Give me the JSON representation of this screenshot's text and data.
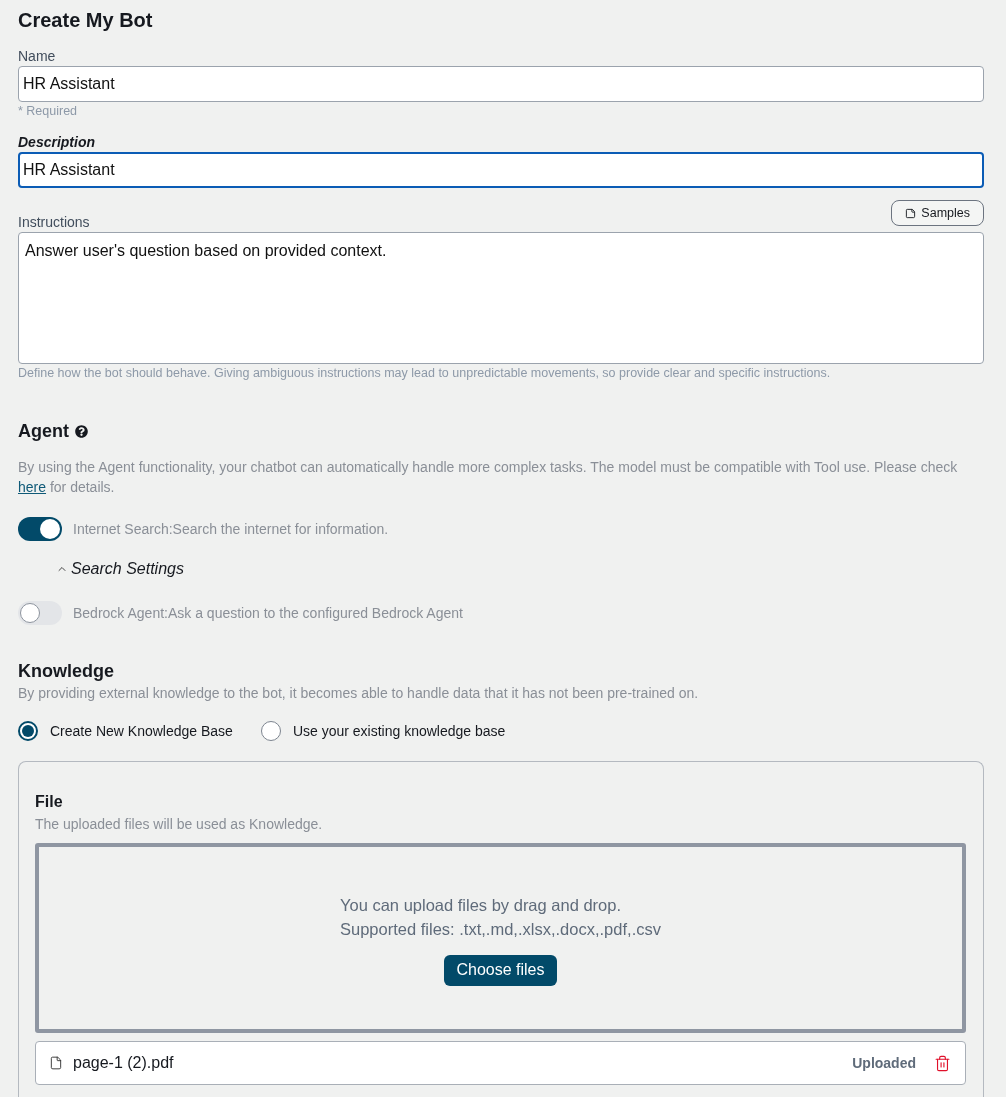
{
  "title": "Create My Bot",
  "name_field": {
    "label": "Name",
    "value": "HR Assistant",
    "hint": "* Required",
    "focused": false
  },
  "description_field": {
    "label": "Description",
    "value": "HR Assistant",
    "focused": true
  },
  "instructions_field": {
    "label": "Instructions",
    "samples_button": "Samples",
    "value": "Answer user's question based on provided context.",
    "help": "Define how the bot should behave. Giving ambiguous instructions may lead to unpredictable movements, so provide clear and specific instructions."
  },
  "agent": {
    "heading": "Agent",
    "description_before": "By using the Agent functionality, your chatbot can automatically handle more complex tasks. The model must be compatible with Tool use. Please check ",
    "link": "here",
    "description_after": " for details.",
    "tools": [
      {
        "label": "Internet Search:Search the internet for information.",
        "on": true,
        "settings": "Search Settings"
      },
      {
        "label": "Bedrock Agent:Ask a question to the configured Bedrock Agent",
        "on": false
      }
    ]
  },
  "knowledge": {
    "heading": "Knowledge",
    "description": "By providing external knowledge to the bot, it becomes able to handle data that it has not been pre-trained on.",
    "options": [
      {
        "label": "Create New Knowledge Base",
        "selected": true
      },
      {
        "label": "Use your existing knowledge base",
        "selected": false
      }
    ],
    "file": {
      "heading": "File",
      "description": "The uploaded files will be used as Knowledge.",
      "dropzone_lines": [
        "You can upload files by drag and drop.",
        "Supported files: .txt,.md,.xlsx,.docx,.pdf,.csv"
      ],
      "button": "Choose files",
      "files": [
        {
          "name": "page-1 (2).pdf",
          "status": "Uploaded"
        }
      ]
    }
  }
}
